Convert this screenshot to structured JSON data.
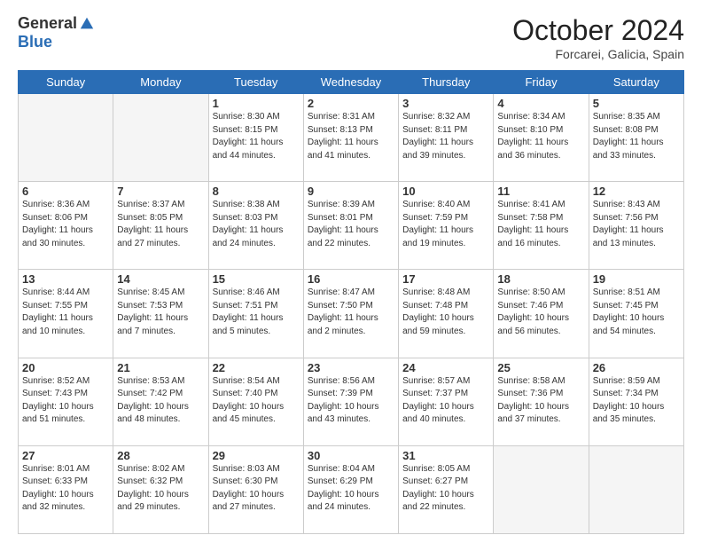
{
  "header": {
    "logo_general": "General",
    "logo_blue": "Blue",
    "month": "October 2024",
    "location": "Forcarei, Galicia, Spain"
  },
  "weekdays": [
    "Sunday",
    "Monday",
    "Tuesday",
    "Wednesday",
    "Thursday",
    "Friday",
    "Saturday"
  ],
  "weeks": [
    [
      {
        "day": "",
        "info": ""
      },
      {
        "day": "",
        "info": ""
      },
      {
        "day": "1",
        "info": "Sunrise: 8:30 AM\nSunset: 8:15 PM\nDaylight: 11 hours and 44 minutes."
      },
      {
        "day": "2",
        "info": "Sunrise: 8:31 AM\nSunset: 8:13 PM\nDaylight: 11 hours and 41 minutes."
      },
      {
        "day": "3",
        "info": "Sunrise: 8:32 AM\nSunset: 8:11 PM\nDaylight: 11 hours and 39 minutes."
      },
      {
        "day": "4",
        "info": "Sunrise: 8:34 AM\nSunset: 8:10 PM\nDaylight: 11 hours and 36 minutes."
      },
      {
        "day": "5",
        "info": "Sunrise: 8:35 AM\nSunset: 8:08 PM\nDaylight: 11 hours and 33 minutes."
      }
    ],
    [
      {
        "day": "6",
        "info": "Sunrise: 8:36 AM\nSunset: 8:06 PM\nDaylight: 11 hours and 30 minutes."
      },
      {
        "day": "7",
        "info": "Sunrise: 8:37 AM\nSunset: 8:05 PM\nDaylight: 11 hours and 27 minutes."
      },
      {
        "day": "8",
        "info": "Sunrise: 8:38 AM\nSunset: 8:03 PM\nDaylight: 11 hours and 24 minutes."
      },
      {
        "day": "9",
        "info": "Sunrise: 8:39 AM\nSunset: 8:01 PM\nDaylight: 11 hours and 22 minutes."
      },
      {
        "day": "10",
        "info": "Sunrise: 8:40 AM\nSunset: 7:59 PM\nDaylight: 11 hours and 19 minutes."
      },
      {
        "day": "11",
        "info": "Sunrise: 8:41 AM\nSunset: 7:58 PM\nDaylight: 11 hours and 16 minutes."
      },
      {
        "day": "12",
        "info": "Sunrise: 8:43 AM\nSunset: 7:56 PM\nDaylight: 11 hours and 13 minutes."
      }
    ],
    [
      {
        "day": "13",
        "info": "Sunrise: 8:44 AM\nSunset: 7:55 PM\nDaylight: 11 hours and 10 minutes."
      },
      {
        "day": "14",
        "info": "Sunrise: 8:45 AM\nSunset: 7:53 PM\nDaylight: 11 hours and 7 minutes."
      },
      {
        "day": "15",
        "info": "Sunrise: 8:46 AM\nSunset: 7:51 PM\nDaylight: 11 hours and 5 minutes."
      },
      {
        "day": "16",
        "info": "Sunrise: 8:47 AM\nSunset: 7:50 PM\nDaylight: 11 hours and 2 minutes."
      },
      {
        "day": "17",
        "info": "Sunrise: 8:48 AM\nSunset: 7:48 PM\nDaylight: 10 hours and 59 minutes."
      },
      {
        "day": "18",
        "info": "Sunrise: 8:50 AM\nSunset: 7:46 PM\nDaylight: 10 hours and 56 minutes."
      },
      {
        "day": "19",
        "info": "Sunrise: 8:51 AM\nSunset: 7:45 PM\nDaylight: 10 hours and 54 minutes."
      }
    ],
    [
      {
        "day": "20",
        "info": "Sunrise: 8:52 AM\nSunset: 7:43 PM\nDaylight: 10 hours and 51 minutes."
      },
      {
        "day": "21",
        "info": "Sunrise: 8:53 AM\nSunset: 7:42 PM\nDaylight: 10 hours and 48 minutes."
      },
      {
        "day": "22",
        "info": "Sunrise: 8:54 AM\nSunset: 7:40 PM\nDaylight: 10 hours and 45 minutes."
      },
      {
        "day": "23",
        "info": "Sunrise: 8:56 AM\nSunset: 7:39 PM\nDaylight: 10 hours and 43 minutes."
      },
      {
        "day": "24",
        "info": "Sunrise: 8:57 AM\nSunset: 7:37 PM\nDaylight: 10 hours and 40 minutes."
      },
      {
        "day": "25",
        "info": "Sunrise: 8:58 AM\nSunset: 7:36 PM\nDaylight: 10 hours and 37 minutes."
      },
      {
        "day": "26",
        "info": "Sunrise: 8:59 AM\nSunset: 7:34 PM\nDaylight: 10 hours and 35 minutes."
      }
    ],
    [
      {
        "day": "27",
        "info": "Sunrise: 8:01 AM\nSunset: 6:33 PM\nDaylight: 10 hours and 32 minutes."
      },
      {
        "day": "28",
        "info": "Sunrise: 8:02 AM\nSunset: 6:32 PM\nDaylight: 10 hours and 29 minutes."
      },
      {
        "day": "29",
        "info": "Sunrise: 8:03 AM\nSunset: 6:30 PM\nDaylight: 10 hours and 27 minutes."
      },
      {
        "day": "30",
        "info": "Sunrise: 8:04 AM\nSunset: 6:29 PM\nDaylight: 10 hours and 24 minutes."
      },
      {
        "day": "31",
        "info": "Sunrise: 8:05 AM\nSunset: 6:27 PM\nDaylight: 10 hours and 22 minutes."
      },
      {
        "day": "",
        "info": ""
      },
      {
        "day": "",
        "info": ""
      }
    ]
  ]
}
